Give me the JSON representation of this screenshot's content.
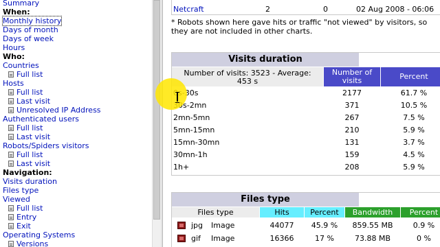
{
  "nav": {
    "items": [
      {
        "kind": "link",
        "label": "Summary"
      },
      {
        "kind": "heading",
        "label": "When:"
      },
      {
        "kind": "link",
        "label": "Monthly history",
        "selected": true
      },
      {
        "kind": "link",
        "label": "Days of month"
      },
      {
        "kind": "link",
        "label": "Days of week"
      },
      {
        "kind": "link",
        "label": "Hours"
      },
      {
        "kind": "heading",
        "label": "Who:"
      },
      {
        "kind": "link",
        "label": "Countries"
      },
      {
        "kind": "sub",
        "label": "Full list"
      },
      {
        "kind": "link",
        "label": "Hosts"
      },
      {
        "kind": "sub",
        "label": "Full list"
      },
      {
        "kind": "sub",
        "label": "Last visit"
      },
      {
        "kind": "sub",
        "label": "Unresolved IP Address"
      },
      {
        "kind": "link",
        "label": "Authenticated users"
      },
      {
        "kind": "sub",
        "label": "Full list"
      },
      {
        "kind": "sub",
        "label": "Last visit"
      },
      {
        "kind": "link",
        "label": "Robots/Spiders visitors"
      },
      {
        "kind": "sub",
        "label": "Full list"
      },
      {
        "kind": "sub",
        "label": "Last visit"
      },
      {
        "kind": "heading",
        "label": "Navigation:"
      },
      {
        "kind": "link",
        "label": "Visits duration"
      },
      {
        "kind": "link",
        "label": "Files type"
      },
      {
        "kind": "link",
        "label": "Viewed"
      },
      {
        "kind": "sub",
        "label": "Full list"
      },
      {
        "kind": "sub",
        "label": "Entry"
      },
      {
        "kind": "sub",
        "label": "Exit"
      },
      {
        "kind": "link",
        "label": "Operating Systems"
      },
      {
        "kind": "sub",
        "label": "Versions"
      }
    ]
  },
  "robots": {
    "row": {
      "name": "Netcraft",
      "hits": "2",
      "bandwidth": "0",
      "last_visit": "02 Aug 2008 - 06:06"
    },
    "note": "* Robots shown here gave hits or traffic \"not viewed\" by visitors, so they are not included in other charts."
  },
  "visits_duration": {
    "title": "Visits duration",
    "summary": "Number of visits: 3523 - Average: 453 s",
    "col_visits": "Number of visits",
    "col_percent": "Percent",
    "rows": [
      {
        "range": "0s-30s",
        "visits": "2177",
        "percent": "61.7 %"
      },
      {
        "range": "30s-2mn",
        "visits": "371",
        "percent": "10.5 %"
      },
      {
        "range": "2mn-5mn",
        "visits": "267",
        "percent": "7.5 %"
      },
      {
        "range": "5mn-15mn",
        "visits": "210",
        "percent": "5.9 %"
      },
      {
        "range": "15mn-30mn",
        "visits": "131",
        "percent": "3.7 %"
      },
      {
        "range": "30mn-1h",
        "visits": "159",
        "percent": "4.5 %"
      },
      {
        "range": "1h+",
        "visits": "208",
        "percent": "5.9 %"
      }
    ]
  },
  "files_type": {
    "title": "Files type",
    "col_type": "Files type",
    "col_hits": "Hits",
    "col_percent": "Percent",
    "col_bandwidth": "Bandwidth",
    "col_bw_percent": "Percent",
    "rows": [
      {
        "ext": "jpg",
        "desc": "Image",
        "hits": "44077",
        "hits_pct": "45.9 %",
        "bandwidth": "859.55 MB",
        "bw_pct": "0.9 %"
      },
      {
        "ext": "gif",
        "desc": "Image",
        "hits": "16366",
        "hits_pct": "17 %",
        "bandwidth": "73.88 MB",
        "bw_pct": "0 %"
      }
    ]
  },
  "colors": {
    "link": "#0011bb",
    "section_header": "#cfcfe0",
    "visits_header": "#4a4ac8",
    "hits_header": "#66eeff",
    "bandwidth_header": "#2ca02c",
    "cursor_highlight": "#ffe600"
  }
}
